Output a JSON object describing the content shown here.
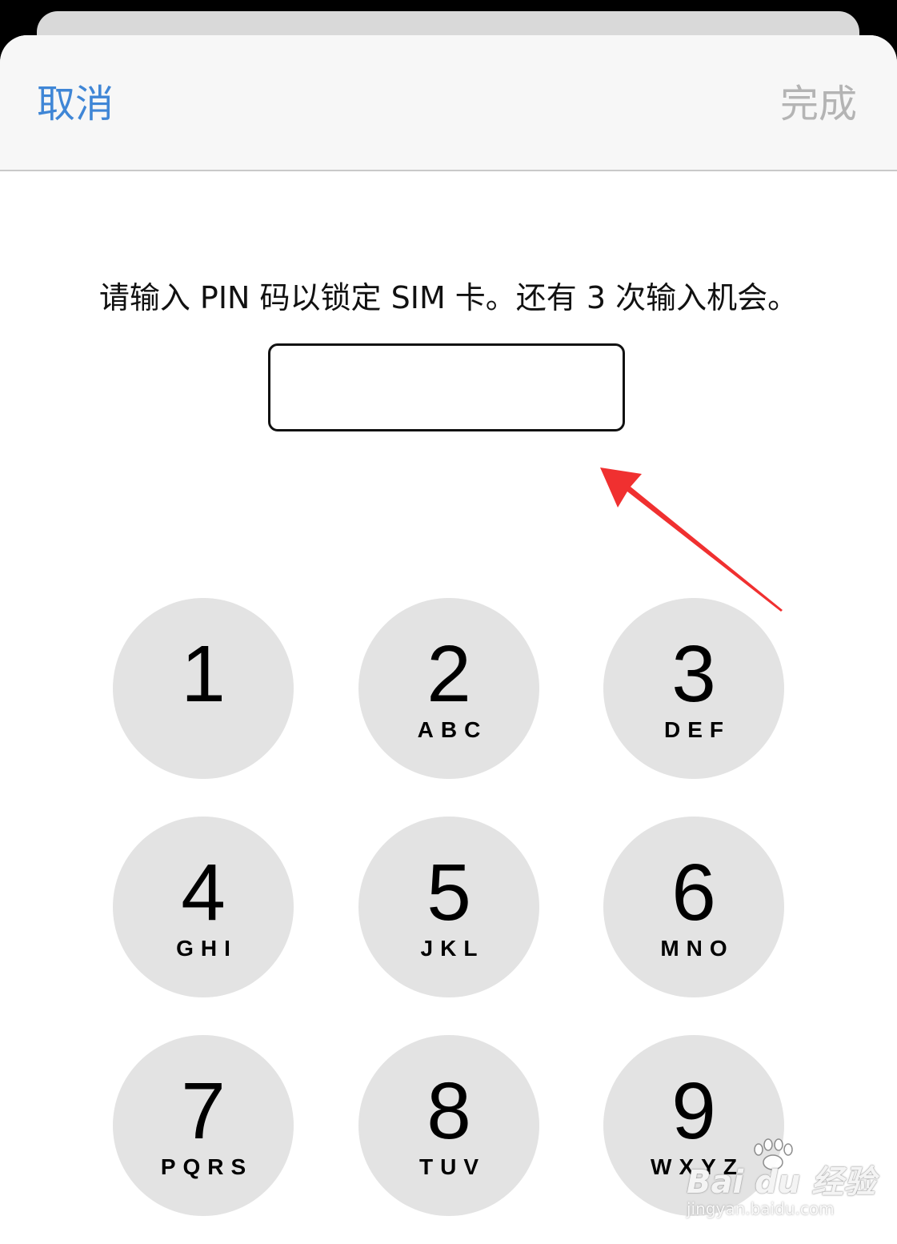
{
  "nav": {
    "cancel_label": "取消",
    "done_label": "完成",
    "cancel_color": "#3f86d6",
    "done_color": "#b4b4b4"
  },
  "prompt": {
    "text": "请输入 PIN 码以锁定 SIM 卡。还有 3 次输入机会。"
  },
  "pin_input": {
    "value": ""
  },
  "annotation": {
    "arrow_icon": "red-arrow-icon",
    "arrow_color": "#f03030"
  },
  "keypad": {
    "keys": [
      {
        "digit": "1",
        "letters": ""
      },
      {
        "digit": "2",
        "letters": "ABC"
      },
      {
        "digit": "3",
        "letters": "DEF"
      },
      {
        "digit": "4",
        "letters": "GHI"
      },
      {
        "digit": "5",
        "letters": "JKL"
      },
      {
        "digit": "6",
        "letters": "MNO"
      },
      {
        "digit": "7",
        "letters": "PQRS"
      },
      {
        "digit": "8",
        "letters": "TUV"
      },
      {
        "digit": "9",
        "letters": "WXYZ"
      }
    ]
  },
  "watermark": {
    "logo_text": "Bai du 经验",
    "url": "jingyan.baidu.com"
  }
}
